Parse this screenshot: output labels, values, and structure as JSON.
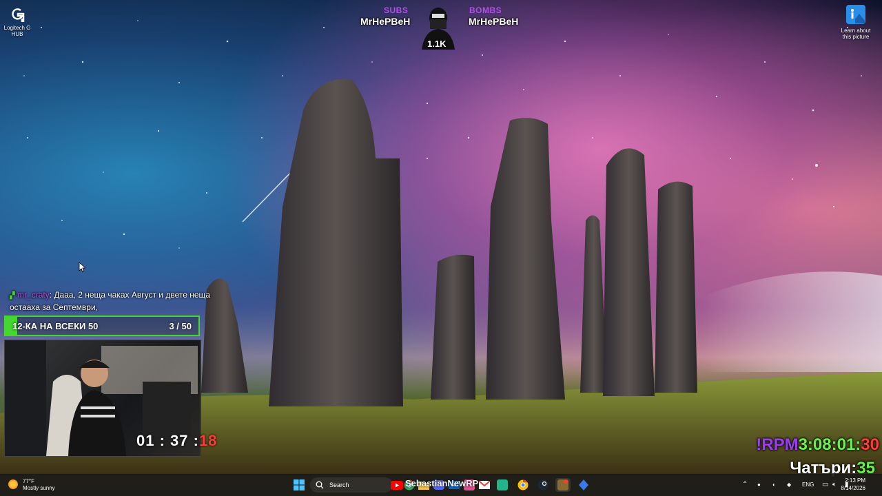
{
  "desktop": {
    "icons": [
      {
        "label_line1": "Logitech G",
        "label_line2": "HUB"
      },
      {
        "label_line1": "Learn about",
        "label_line2": "this picture"
      }
    ]
  },
  "overlay": {
    "subs_label": "SUBS",
    "subs_name": "MrHePBeH",
    "bombs_label": "BOMBS",
    "bombs_name": "MrHePBeH",
    "follower_count": "1.1K",
    "chat": {
      "user": "mr_craty",
      "message": ": Дааа, 2 неща чаках Август и двете неща остааха за Септември,"
    },
    "goal": {
      "label": "12-КА НА ВСЕКИ 50",
      "count": "3 / 50",
      "progress": 0.06
    },
    "timer": {
      "main": "01 : 37 :",
      "secs": "18"
    },
    "rpm": {
      "label": "!RPM",
      "time": "3:08:01:",
      "secs": "30"
    },
    "chatri": {
      "label": "Чатъри:",
      "value": "35"
    },
    "stream_name": "SebastianNewRP"
  },
  "taskbar": {
    "weather_temp": "77°F",
    "weather_desc": "Mostly sunny",
    "search_placeholder": "Search",
    "language": "ENG",
    "time": "2:13 PM",
    "date": "8/14/2026"
  }
}
